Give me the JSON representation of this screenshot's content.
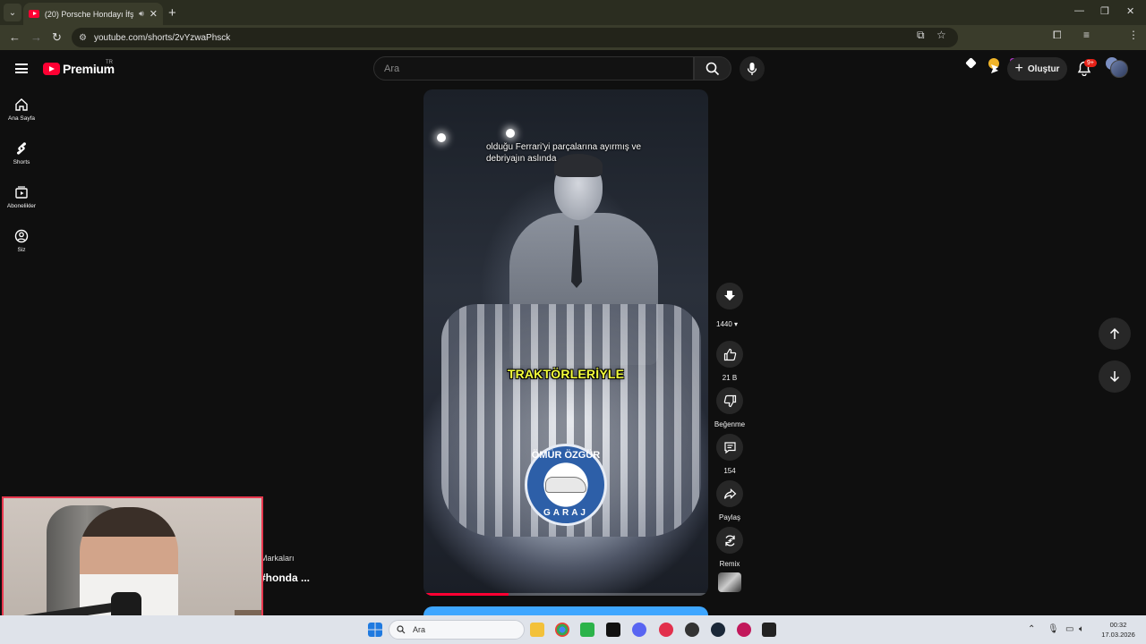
{
  "browser": {
    "tab_title": "(20) Porsche Hondayı İfşa Et",
    "url": "youtube.com/shorts/2vYzwaPhsck"
  },
  "header": {
    "logo_text": "Premium",
    "logo_region": "TR",
    "search_placeholder": "Ara",
    "create_label": "Oluştur",
    "notification_count": "9+"
  },
  "sidebar": {
    "items": [
      {
        "label": "Ana Sayfa",
        "icon": "home-icon"
      },
      {
        "label": "Shorts",
        "icon": "shorts-icon"
      },
      {
        "label": "Abonelikler",
        "icon": "subscriptions-icon"
      },
      {
        "label": "Siz",
        "icon": "account-icon"
      }
    ]
  },
  "video": {
    "caption": "olduğu Ferrari'yi parçalarına ayırmış ve debriyajın aslında",
    "subtitle_highlight": "TRAKTÖRLERİYLE",
    "watermark_top": "ÖMÜR ÖZGÜR",
    "watermark_bottom": "GARAJ",
    "progress_fraction": 0.3
  },
  "actions": {
    "quality": "1440",
    "likes": "21 B",
    "dislike_label": "Beğenme",
    "comments": "154",
    "share_label": "Paylaş",
    "remix_label": "Remix"
  },
  "peek": {
    "channel_line": "Markaları",
    "title_line": "#honda ..."
  },
  "taskbar": {
    "search_placeholder": "Ara",
    "time": "00:32",
    "date": "17.03.2026"
  },
  "colors": {
    "youtube_red": "#ff0033",
    "background": "#0f0f0f",
    "subtitle_yellow": "#f5ff3c",
    "webcam_border": "#e8384f"
  }
}
